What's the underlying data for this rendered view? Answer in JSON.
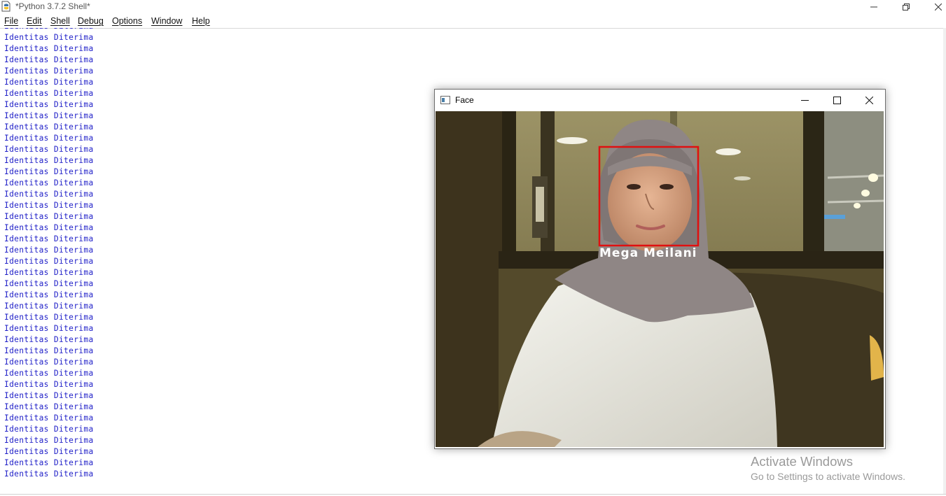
{
  "window": {
    "title": "*Python 3.7.2 Shell*"
  },
  "menu": [
    "File",
    "Edit",
    "Shell",
    "Debug",
    "Options",
    "Window",
    "Help"
  ],
  "shell": {
    "output_line": "Identitas Diterima",
    "visible_line_count": 41
  },
  "face_window": {
    "title": "Face",
    "detected_name": "Mega Meilani",
    "box_color": "#e01010"
  },
  "watermark": {
    "title": "Activate Windows",
    "subtitle": "Go to Settings to activate Windows."
  },
  "colors": {
    "shell_output": "#1f1fc8"
  }
}
